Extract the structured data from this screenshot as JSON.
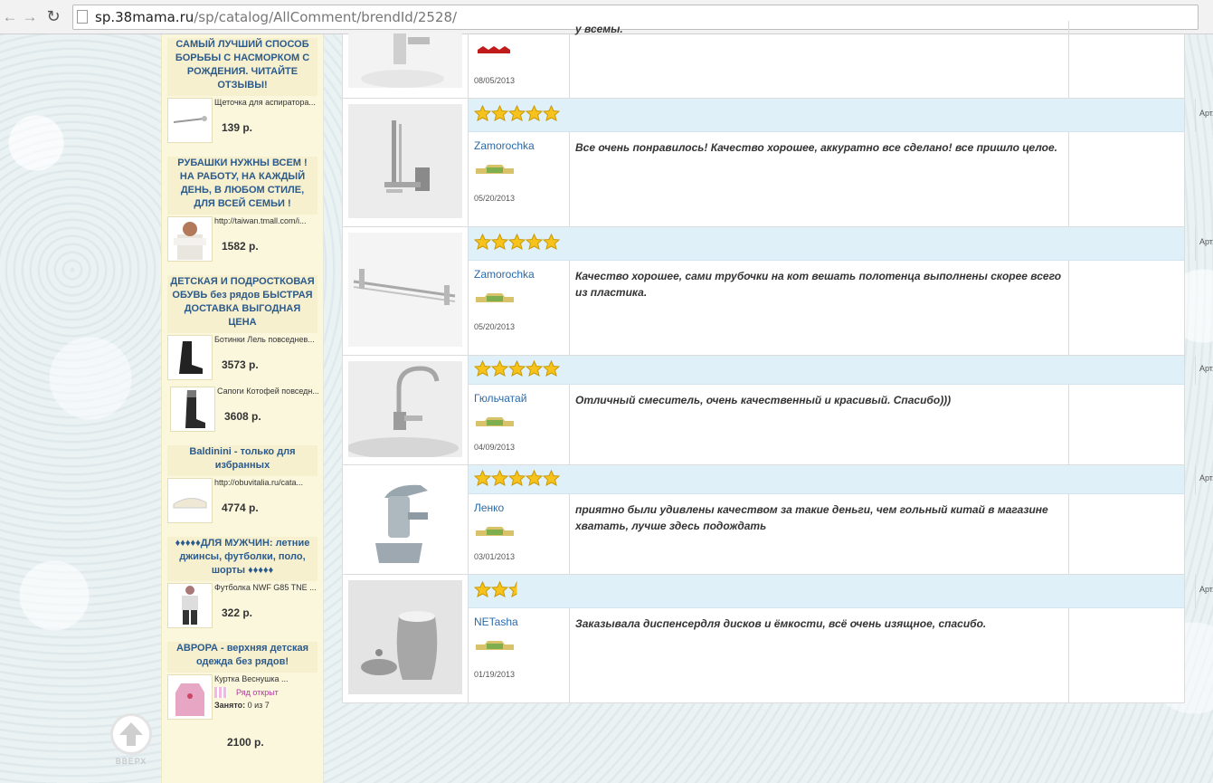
{
  "browser": {
    "url_domain": "sp.38mama.ru",
    "url_path": "/sp/catalog/AllComment/brendId/2528/"
  },
  "sidebar": {
    "promos": [
      {
        "title": "САМЫЙ ЛУЧШИЙ СПОСОБ БОРЬБЫ С НАСМОРКОМ С РОЖДЕНИЯ. ЧИТАЙТЕ ОТЗЫВЫ!",
        "items": [
          {
            "name": "Щеточка для аспиратора...",
            "price": "139 р."
          }
        ]
      },
      {
        "title": "РУБАШКИ НУЖНЫ ВСЕМ ! НА РАБОТУ, НА КАЖДЫЙ ДЕНЬ, В ЛЮБОМ СТИЛЕ, ДЛЯ ВСЕЙ СЕМЬИ !",
        "items": [
          {
            "name": "http://taiwan.tmall.com/i...",
            "price": "1582 р."
          }
        ]
      },
      {
        "title": "ДЕТСКАЯ И ПОДРОСТКОВАЯ ОБУВЬ без рядов БЫСТРАЯ ДОСТАВКА ВЫГОДНАЯ ЦЕНА",
        "items": [
          {
            "name": "Ботинки Лель повседнев...",
            "price": "3573 р."
          },
          {
            "name": "Сапоги Котофей повседн...",
            "price": "3608 р."
          }
        ]
      },
      {
        "title": "Baldinini - только для избранных",
        "items": [
          {
            "name": "http://obuvitalia.ru/cata...",
            "price": "4774 р."
          }
        ]
      },
      {
        "title": "♦♦♦♦♦ДЛЯ МУЖЧИН: летние джинсы, футболки, поло, шорты ♦♦♦♦♦",
        "items": [
          {
            "name": "Футболка NWF G85 TNE ...",
            "price": "322 р."
          }
        ]
      },
      {
        "title": "АВРОРА - верхняя детская одежда без рядов!",
        "items": [
          {
            "name": "Куртка Веснушка ...",
            "row_status": "Ряд открыт",
            "taken_label": "Занято:",
            "taken_value": "0 из 7",
            "price": "2100 р."
          }
        ]
      }
    ]
  },
  "up_button": {
    "label": "ВВЕРХ"
  },
  "comments": {
    "art_label": "Арт.",
    "partial_first": {
      "date": "08/05/2013",
      "text_fragment": "у всемы."
    },
    "rows": [
      {
        "rating": 5,
        "author": "Zamorochka",
        "date": "05/20/2013",
        "text": "Все очень понравилось! Качество хорошее, аккуратно все сделано! все пришло целое.",
        "product_icon": "toilet-paper-holder"
      },
      {
        "rating": 5,
        "author": "Zamorochka",
        "date": "05/20/2013",
        "text": "Качество хорошее, сами трубочки на кот вешать полотенца выполнены скорее всего из пластика.",
        "product_icon": "towel-rail"
      },
      {
        "rating": 5,
        "author": "Гюльчатай",
        "date": "04/09/2013",
        "text": "Отличный смеситель, очень качественный и красивый. Спасибо)))",
        "product_icon": "kitchen-faucet"
      },
      {
        "rating": 5,
        "author": "Ленко",
        "date": "03/01/2013",
        "text": "приятно были удивлены качеством за такие деньги, чем гольный китай в магазине хватать, лучше здесь подождать",
        "product_icon": "bidet-mixer"
      },
      {
        "rating": 2.5,
        "author": "NETasha",
        "date": "01/19/2013",
        "text": "Заказывала диспенсердля дисков и ёмкости, всё очень изящное, спасибо.",
        "product_icon": "cotton-dispenser"
      }
    ]
  }
}
